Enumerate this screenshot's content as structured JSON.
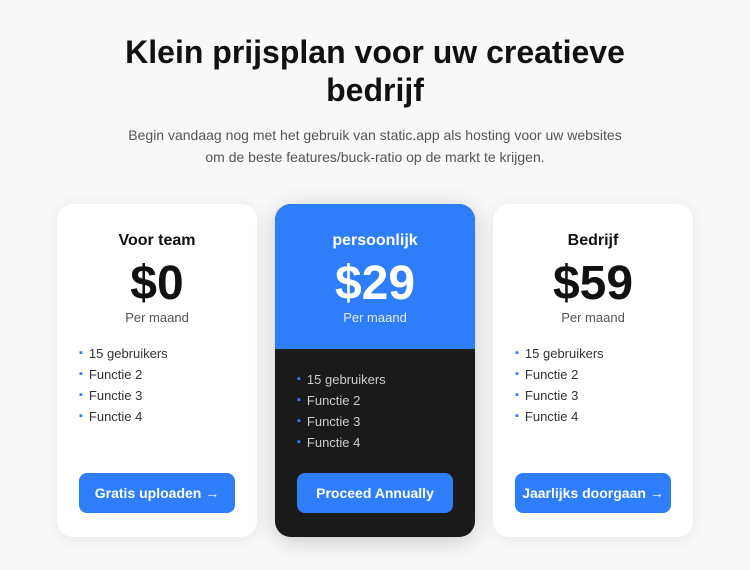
{
  "header": {
    "title": "Klein prijsplan voor uw creatieve bedrijf",
    "subtitle": "Begin vandaag nog met het gebruik van static.app als hosting voor uw websites om de beste features/buck-ratio op de markt te krijgen."
  },
  "plans": [
    {
      "id": "team",
      "title": "Voor team",
      "price": "$0",
      "period": "Per maand",
      "features": [
        "15 gebruikers",
        "Functie 2",
        "Functie 3",
        "Functie 4"
      ],
      "button_label": "Gratis uploaden →",
      "featured": false
    },
    {
      "id": "personal",
      "title": "persoonlijk",
      "price": "$29",
      "period": "Per maand",
      "features": [
        "15 gebruikers",
        "Functie 2",
        "Functie 3",
        "Functie 4"
      ],
      "button_label": "Proceed Annually",
      "featured": true
    },
    {
      "id": "business",
      "title": "Bedrijf",
      "price": "$59",
      "period": "Per maand",
      "features": [
        "15 gebruikers",
        "Functie 2",
        "Functie 3",
        "Functie 4"
      ],
      "button_label": "Jaarlijks doorgaan →",
      "featured": false
    }
  ]
}
